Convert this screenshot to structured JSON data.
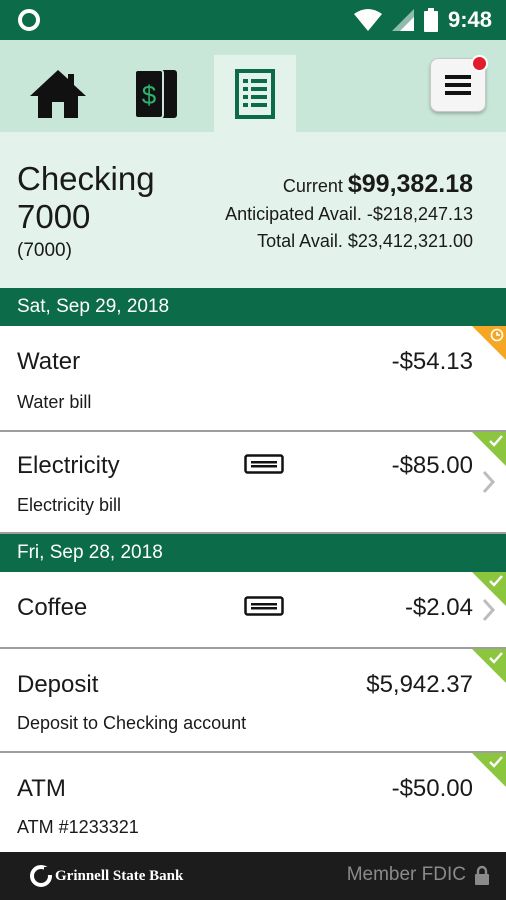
{
  "status_bar": {
    "time": "9:48"
  },
  "nav": {
    "tabs": [
      {
        "name": "home",
        "icon": "home-icon"
      },
      {
        "name": "transfers",
        "icon": "dollar-bill-icon"
      },
      {
        "name": "accounts",
        "icon": "ledger-icon",
        "active": true
      }
    ],
    "menu_icon": "hamburger-menu-icon",
    "menu_has_notification": true
  },
  "account": {
    "name": "Checking 7000",
    "number": "(7000)",
    "current_label": "Current",
    "current_value": "$99,382.18",
    "anticipated_label": "Anticipated Avail.",
    "anticipated_value": "-$218,247.13",
    "total_label": "Total Avail.",
    "total_value": "$23,412,321.00"
  },
  "transactions": {
    "groups": [
      {
        "date": "Sat, Sep 29, 2018",
        "items": [
          {
            "title": "Water",
            "description": "Water bill",
            "amount": "-$54.13",
            "status": "pending"
          },
          {
            "title": "Electricity",
            "description": "Electricity bill",
            "amount": "-$85.00",
            "status": "cleared",
            "card": true,
            "chevron": true
          }
        ]
      },
      {
        "date": "Fri, Sep 28, 2018",
        "items": [
          {
            "title": "Coffee",
            "description": "",
            "amount": "-$2.04",
            "status": "cleared",
            "card": true,
            "chevron": true
          },
          {
            "title": "Deposit",
            "description": "Deposit to Checking account",
            "amount": "$5,942.37",
            "status": "cleared"
          },
          {
            "title": "ATM",
            "description": "ATM #1233321",
            "amount": "-$50.00",
            "status": "cleared"
          }
        ]
      }
    ]
  },
  "colors": {
    "brand_green": "#0c6b49",
    "tab_bar": "#c9e7d9",
    "panel": "#e3f2ea",
    "cleared": "#8cc63f",
    "pending": "#f5a623",
    "notification": "#e21b2d"
  },
  "footer": {
    "bank_name": "Grinnell State Bank",
    "member_text": "Member FDIC"
  }
}
